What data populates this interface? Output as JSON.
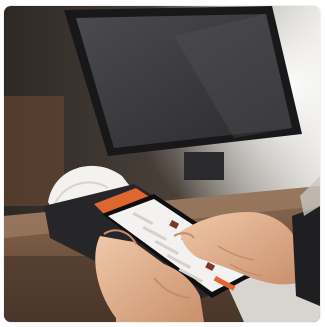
{
  "image": {
    "subject": "hand-held-pos-terminal-printing-receipt",
    "palette": {
      "background_dark": "#3a3430",
      "monitor_black": "#1e1e20",
      "screen_glass": "#3d3d40",
      "window_light": "#f4f4f2",
      "counter_wood": "#7a5a45",
      "terminal_black": "#2a2a2c",
      "accent_orange": "#e0662f",
      "paper_white": "#f2f0ec",
      "skin": "#e3b595"
    }
  }
}
